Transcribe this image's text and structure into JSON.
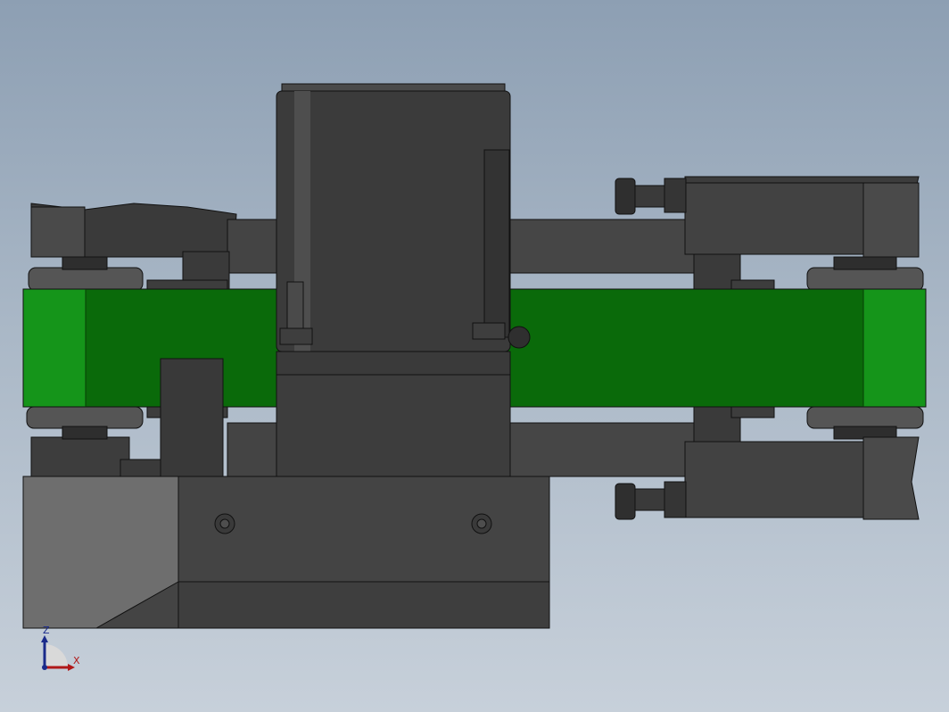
{
  "viewport": {
    "background_top": "#8d9fb3",
    "background_bottom": "#c7d0da"
  },
  "model": {
    "belt_color": "#0a6a0a",
    "belt_highlight": "#19a019",
    "body_color": "#3f3f3f",
    "dark_color": "#2a2a2a",
    "light_face_color": "#6e6e6e"
  },
  "triad": {
    "z_label": "Z",
    "x_label": "X",
    "z_color": "#1a2a8a",
    "x_color": "#b01818"
  }
}
